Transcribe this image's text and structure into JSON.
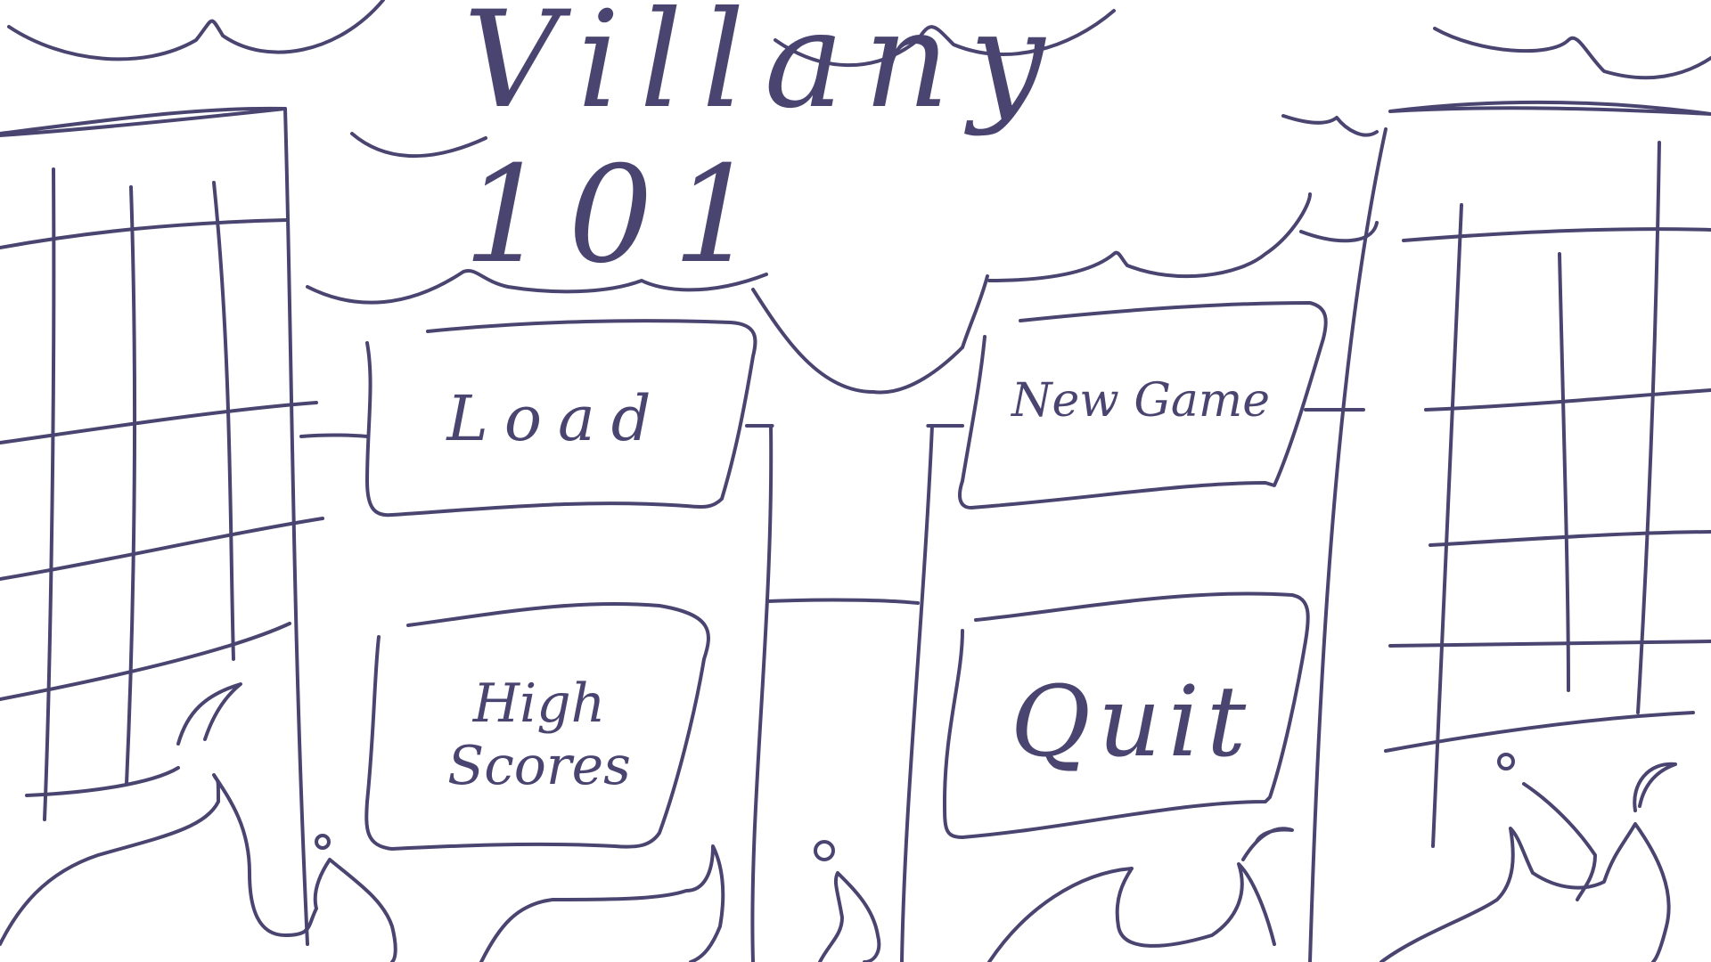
{
  "game": {
    "title": "Villany 101"
  },
  "menu": {
    "load_label": "Load",
    "new_game_label": "New Game",
    "high_scores_label": "High Scores",
    "quit_label": "Quit"
  },
  "colors": {
    "ink": "#4a4570",
    "background": "#ffffff"
  },
  "icons": [
    "cloud-icon",
    "building-icon",
    "flame-icon",
    "sign-post-icon"
  ]
}
